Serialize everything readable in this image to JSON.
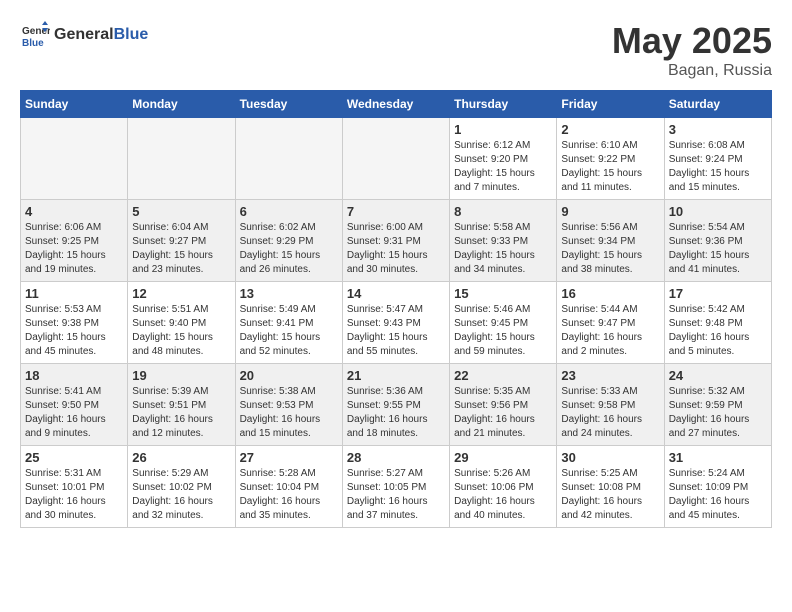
{
  "logo": {
    "general": "General",
    "blue": "Blue"
  },
  "title": {
    "month_year": "May 2025",
    "location": "Bagan, Russia"
  },
  "weekdays": [
    "Sunday",
    "Monday",
    "Tuesday",
    "Wednesday",
    "Thursday",
    "Friday",
    "Saturday"
  ],
  "weeks": [
    [
      {
        "day": "",
        "info": ""
      },
      {
        "day": "",
        "info": ""
      },
      {
        "day": "",
        "info": ""
      },
      {
        "day": "",
        "info": ""
      },
      {
        "day": "1",
        "info": "Sunrise: 6:12 AM\nSunset: 9:20 PM\nDaylight: 15 hours\nand 7 minutes."
      },
      {
        "day": "2",
        "info": "Sunrise: 6:10 AM\nSunset: 9:22 PM\nDaylight: 15 hours\nand 11 minutes."
      },
      {
        "day": "3",
        "info": "Sunrise: 6:08 AM\nSunset: 9:24 PM\nDaylight: 15 hours\nand 15 minutes."
      }
    ],
    [
      {
        "day": "4",
        "info": "Sunrise: 6:06 AM\nSunset: 9:25 PM\nDaylight: 15 hours\nand 19 minutes."
      },
      {
        "day": "5",
        "info": "Sunrise: 6:04 AM\nSunset: 9:27 PM\nDaylight: 15 hours\nand 23 minutes."
      },
      {
        "day": "6",
        "info": "Sunrise: 6:02 AM\nSunset: 9:29 PM\nDaylight: 15 hours\nand 26 minutes."
      },
      {
        "day": "7",
        "info": "Sunrise: 6:00 AM\nSunset: 9:31 PM\nDaylight: 15 hours\nand 30 minutes."
      },
      {
        "day": "8",
        "info": "Sunrise: 5:58 AM\nSunset: 9:33 PM\nDaylight: 15 hours\nand 34 minutes."
      },
      {
        "day": "9",
        "info": "Sunrise: 5:56 AM\nSunset: 9:34 PM\nDaylight: 15 hours\nand 38 minutes."
      },
      {
        "day": "10",
        "info": "Sunrise: 5:54 AM\nSunset: 9:36 PM\nDaylight: 15 hours\nand 41 minutes."
      }
    ],
    [
      {
        "day": "11",
        "info": "Sunrise: 5:53 AM\nSunset: 9:38 PM\nDaylight: 15 hours\nand 45 minutes."
      },
      {
        "day": "12",
        "info": "Sunrise: 5:51 AM\nSunset: 9:40 PM\nDaylight: 15 hours\nand 48 minutes."
      },
      {
        "day": "13",
        "info": "Sunrise: 5:49 AM\nSunset: 9:41 PM\nDaylight: 15 hours\nand 52 minutes."
      },
      {
        "day": "14",
        "info": "Sunrise: 5:47 AM\nSunset: 9:43 PM\nDaylight: 15 hours\nand 55 minutes."
      },
      {
        "day": "15",
        "info": "Sunrise: 5:46 AM\nSunset: 9:45 PM\nDaylight: 15 hours\nand 59 minutes."
      },
      {
        "day": "16",
        "info": "Sunrise: 5:44 AM\nSunset: 9:47 PM\nDaylight: 16 hours\nand 2 minutes."
      },
      {
        "day": "17",
        "info": "Sunrise: 5:42 AM\nSunset: 9:48 PM\nDaylight: 16 hours\nand 5 minutes."
      }
    ],
    [
      {
        "day": "18",
        "info": "Sunrise: 5:41 AM\nSunset: 9:50 PM\nDaylight: 16 hours\nand 9 minutes."
      },
      {
        "day": "19",
        "info": "Sunrise: 5:39 AM\nSunset: 9:51 PM\nDaylight: 16 hours\nand 12 minutes."
      },
      {
        "day": "20",
        "info": "Sunrise: 5:38 AM\nSunset: 9:53 PM\nDaylight: 16 hours\nand 15 minutes."
      },
      {
        "day": "21",
        "info": "Sunrise: 5:36 AM\nSunset: 9:55 PM\nDaylight: 16 hours\nand 18 minutes."
      },
      {
        "day": "22",
        "info": "Sunrise: 5:35 AM\nSunset: 9:56 PM\nDaylight: 16 hours\nand 21 minutes."
      },
      {
        "day": "23",
        "info": "Sunrise: 5:33 AM\nSunset: 9:58 PM\nDaylight: 16 hours\nand 24 minutes."
      },
      {
        "day": "24",
        "info": "Sunrise: 5:32 AM\nSunset: 9:59 PM\nDaylight: 16 hours\nand 27 minutes."
      }
    ],
    [
      {
        "day": "25",
        "info": "Sunrise: 5:31 AM\nSunset: 10:01 PM\nDaylight: 16 hours\nand 30 minutes."
      },
      {
        "day": "26",
        "info": "Sunrise: 5:29 AM\nSunset: 10:02 PM\nDaylight: 16 hours\nand 32 minutes."
      },
      {
        "day": "27",
        "info": "Sunrise: 5:28 AM\nSunset: 10:04 PM\nDaylight: 16 hours\nand 35 minutes."
      },
      {
        "day": "28",
        "info": "Sunrise: 5:27 AM\nSunset: 10:05 PM\nDaylight: 16 hours\nand 37 minutes."
      },
      {
        "day": "29",
        "info": "Sunrise: 5:26 AM\nSunset: 10:06 PM\nDaylight: 16 hours\nand 40 minutes."
      },
      {
        "day": "30",
        "info": "Sunrise: 5:25 AM\nSunset: 10:08 PM\nDaylight: 16 hours\nand 42 minutes."
      },
      {
        "day": "31",
        "info": "Sunrise: 5:24 AM\nSunset: 10:09 PM\nDaylight: 16 hours\nand 45 minutes."
      }
    ]
  ]
}
